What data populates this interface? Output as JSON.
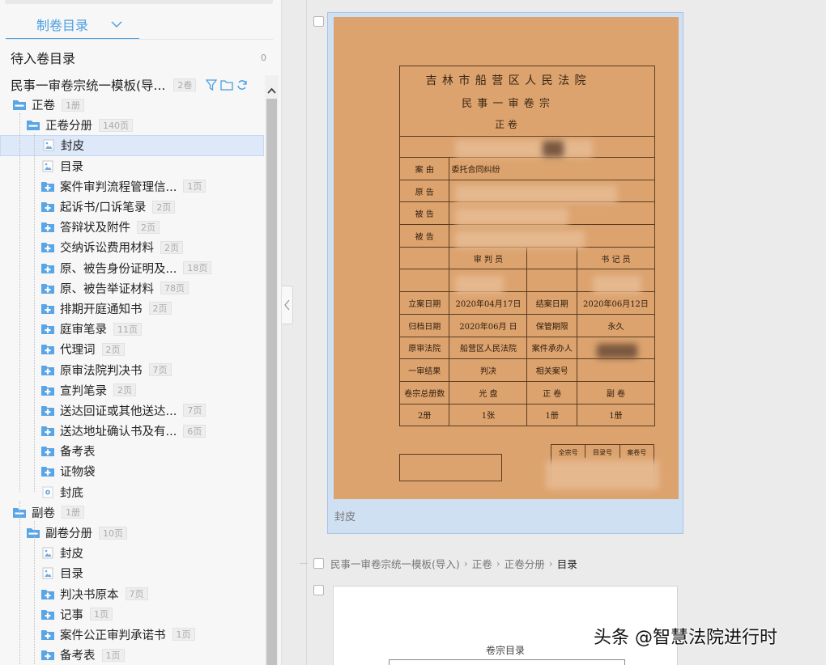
{
  "left_panel": {
    "tab": "制卷目录",
    "pending": {
      "title": "待入卷目录",
      "count": "0"
    },
    "archive": {
      "name": "民事一审卷宗统一模板(导...",
      "badge": "2卷"
    },
    "tree": [
      {
        "level": 0,
        "icon": "folder-open",
        "label": "正卷",
        "badge": "1册"
      },
      {
        "level": 1,
        "icon": "folder-open",
        "label": "正卷分册",
        "badge": "140页"
      },
      {
        "level": 2,
        "icon": "image-file",
        "label": "封皮",
        "badge": "",
        "selected": true
      },
      {
        "level": 2,
        "icon": "image-file",
        "label": "目录",
        "badge": ""
      },
      {
        "level": 2,
        "icon": "plus-folder",
        "label": "案件审判流程管理信...",
        "badge": "1页"
      },
      {
        "level": 2,
        "icon": "plus-folder",
        "label": "起诉书/口诉笔录",
        "badge": "2页"
      },
      {
        "level": 2,
        "icon": "plus-folder",
        "label": "答辩状及附件",
        "badge": "2页"
      },
      {
        "level": 2,
        "icon": "plus-folder",
        "label": "交纳诉讼费用材料",
        "badge": "2页"
      },
      {
        "level": 2,
        "icon": "plus-folder",
        "label": "原、被告身份证明及...",
        "badge": "18页"
      },
      {
        "level": 2,
        "icon": "plus-folder",
        "label": "原、被告举证材料",
        "badge": "78页"
      },
      {
        "level": 2,
        "icon": "plus-folder",
        "label": "排期开庭通知书",
        "badge": "2页"
      },
      {
        "level": 2,
        "icon": "plus-folder",
        "label": "庭审笔录",
        "badge": "11页"
      },
      {
        "level": 2,
        "icon": "plus-folder",
        "label": "代理词",
        "badge": "2页"
      },
      {
        "level": 2,
        "icon": "plus-folder",
        "label": "原审法院判决书",
        "badge": "7页"
      },
      {
        "level": 2,
        "icon": "plus-folder",
        "label": "宣判笔录",
        "badge": "2页"
      },
      {
        "level": 2,
        "icon": "plus-folder",
        "label": "送达回证或其他送达...",
        "badge": "7页"
      },
      {
        "level": 2,
        "icon": "plus-folder",
        "label": "送达地址确认书及有...",
        "badge": "6页"
      },
      {
        "level": 2,
        "icon": "plus-folder",
        "label": "备考表",
        "badge": ""
      },
      {
        "level": 2,
        "icon": "plus-folder",
        "label": "证物袋",
        "badge": ""
      },
      {
        "level": 2,
        "icon": "back-cover",
        "label": "封底",
        "badge": ""
      },
      {
        "level": 0,
        "icon": "folder-open",
        "label": "副卷",
        "badge": "1册"
      },
      {
        "level": 1,
        "icon": "folder-open",
        "label": "副卷分册",
        "badge": "10页"
      },
      {
        "level": 2,
        "icon": "image-file",
        "label": "封皮",
        "badge": ""
      },
      {
        "level": 2,
        "icon": "image-file",
        "label": "目录",
        "badge": ""
      },
      {
        "level": 2,
        "icon": "plus-folder",
        "label": "判决书原本",
        "badge": "7页"
      },
      {
        "level": 2,
        "icon": "plus-folder",
        "label": "记事",
        "badge": "1页"
      },
      {
        "level": 2,
        "icon": "plus-folder",
        "label": "案件公正审判承诺书",
        "badge": "1页"
      },
      {
        "level": 2,
        "icon": "plus-folder",
        "label": "备考表",
        "badge": "1页"
      }
    ]
  },
  "viewer": {
    "card_caption": "封皮",
    "cover": {
      "court": "吉 林 市 船 营 区 人 民 法 院",
      "type": "民 事 一 审 卷 宗",
      "volume": "正 卷",
      "rows": {
        "cause_label": "案  由",
        "cause_value": "委托合同纠纷",
        "plaintiff_label": "原  告",
        "defendant1_label": "被  告",
        "defendant2_label": "被  告",
        "judge_label": "审  判  员",
        "clerk_label": "书  记  员",
        "filed_label": "立案日期",
        "filed_value": "2020年04月17日",
        "closed_label": "结案日期",
        "closed_value": "2020年06月12日",
        "archived_label": "归档日期",
        "archived_value": "2020年06月  日",
        "retention_label": "保管期限",
        "retention_value": "永久",
        "orig_court_label": "原审法院",
        "orig_court_value": "船营区人民法院",
        "handler_label": "案件承办人",
        "result_label": "一审结果",
        "result_value": "判决",
        "related_label": "相关案号",
        "total_label": "卷宗总册数",
        "disc_label": "光  盘",
        "main_label": "正  卷",
        "sub_label": "副  卷",
        "total_value": "2册",
        "disc_value": "1张",
        "main_value": "1册",
        "sub_value": "1册"
      },
      "box_labels": {
        "fonds": "全宗号",
        "catalog": "目录号",
        "file": "案卷号"
      }
    },
    "breadcrumb": {
      "items": [
        "民事一审卷宗统一模板(导入)",
        "正卷",
        "正卷分册"
      ],
      "current": "目录"
    },
    "page2_title": "卷宗目录"
  },
  "watermark": "头条 @智慧法院进行时",
  "colors": {
    "accent": "#4a9fe0",
    "selected_bg": "#dde9f8",
    "cover_paper": "#dca36f"
  }
}
